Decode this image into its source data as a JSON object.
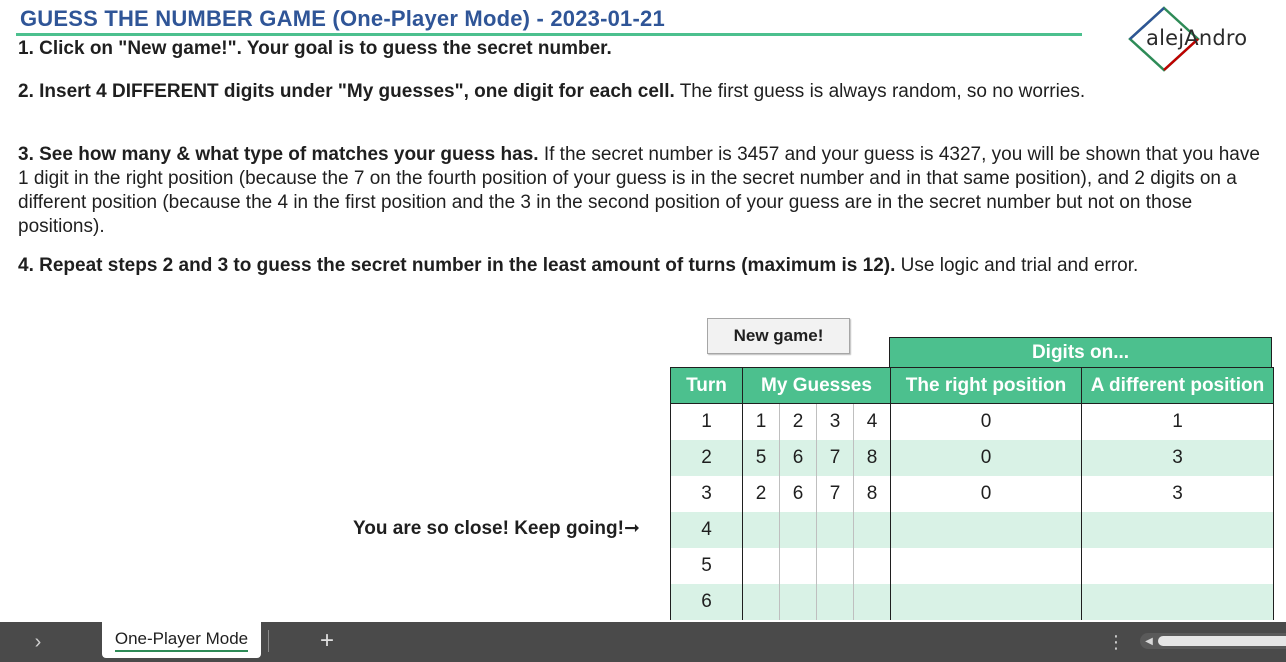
{
  "title": "GUESS THE NUMBER GAME (One-Player Mode) - 2023-01-21",
  "logo": {
    "text": "alejAndro",
    "icon": "diamond-logo-icon",
    "colors": [
      "#2e8b57",
      "#2f5597",
      "#c00000"
    ]
  },
  "steps": [
    {
      "bold": "1. Click on \"New game!\". Your goal is to guess the secret number.",
      "rest": ""
    },
    {
      "bold": "2. Insert 4 DIFFERENT digits under \"My guesses\", one digit for each cell.",
      "rest": " The first guess is always random, so no worries."
    },
    {
      "bold": "3. See how many & what type of matches your guess has.",
      "rest": " If the secret number is 3457 and your guess is 4327, you will be shown that you have 1 digit in the right position (because the 7 on the fourth position of your guess is in the secret number and in that same position), and 2 digits on a different position (because the 4 in the first position and the 3 in the second position of your guess are in the secret number but not on those positions)."
    },
    {
      "bold": "4. Repeat steps 2 and 3 to guess the secret number in the least amount of turns (maximum is 12).",
      "rest": " Use logic and trial and error."
    }
  ],
  "new_game_label": "New game!",
  "table": {
    "group_header": "Digits on...",
    "headers": {
      "turn": "Turn",
      "guesses": "My Guesses",
      "right": "The right position",
      "different": "A different position"
    },
    "rows": [
      {
        "turn": "1",
        "guess": [
          "1",
          "2",
          "3",
          "4"
        ],
        "right": "0",
        "different": "1"
      },
      {
        "turn": "2",
        "guess": [
          "5",
          "6",
          "7",
          "8"
        ],
        "right": "0",
        "different": "3"
      },
      {
        "turn": "3",
        "guess": [
          "2",
          "6",
          "7",
          "8"
        ],
        "right": "0",
        "different": "3"
      },
      {
        "turn": "4",
        "guess": [
          "",
          "",
          "",
          ""
        ],
        "right": "",
        "different": ""
      },
      {
        "turn": "5",
        "guess": [
          "",
          "",
          "",
          ""
        ],
        "right": "",
        "different": ""
      },
      {
        "turn": "6",
        "guess": [
          "",
          "",
          "",
          ""
        ],
        "right": "",
        "different": ""
      }
    ]
  },
  "hint": "You are so close! Keep going!➞",
  "tabs": {
    "active": "One-Player Mode",
    "nav_icon": "chevron-right-icon",
    "add_icon": "plus-icon",
    "more_icon": "vertical-ellipsis-icon"
  },
  "colors": {
    "accent": "#4cc08e",
    "title": "#2f5597",
    "band": "#d9f2e6",
    "tabbar": "#4a4a4a"
  }
}
